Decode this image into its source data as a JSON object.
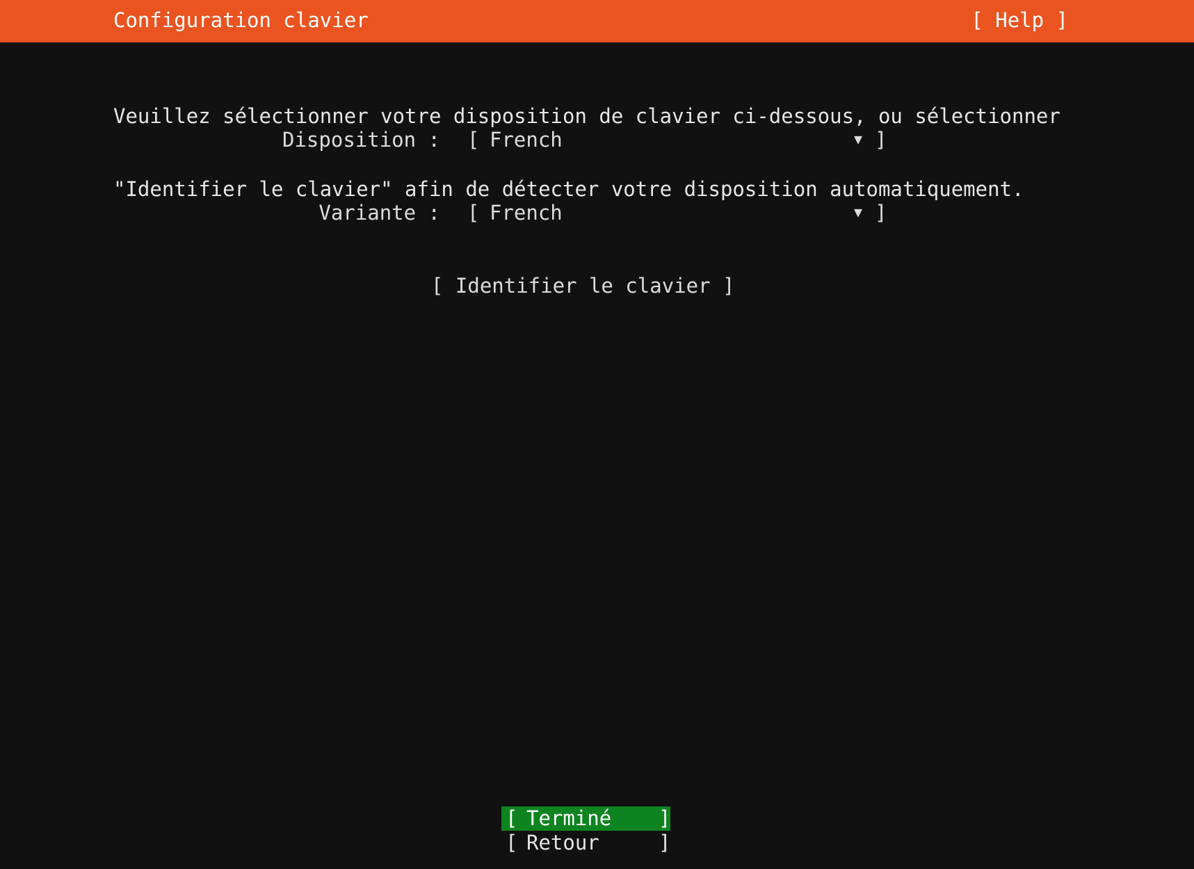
{
  "header": {
    "title": "Configuration clavier",
    "help_label": "[ Help ]",
    "background_color": "#e95420"
  },
  "intro": {
    "line1": "Veuillez sélectionner votre disposition de clavier ci-dessous, ou sélectionner",
    "line2": "\"Identifier le clavier\" afin de détecter votre disposition automatiquement."
  },
  "fields": {
    "layout": {
      "label": "Disposition :",
      "value": "French"
    },
    "variant": {
      "label": "Variante :",
      "value": "French"
    }
  },
  "identify_button": {
    "label": "[ Identifier le clavier ]"
  },
  "footer": {
    "done_label": "Terminé",
    "back_label": "Retour",
    "done_color": "#0e8420"
  },
  "icons": {
    "dropdown_arrow": "chevron-down-icon"
  }
}
